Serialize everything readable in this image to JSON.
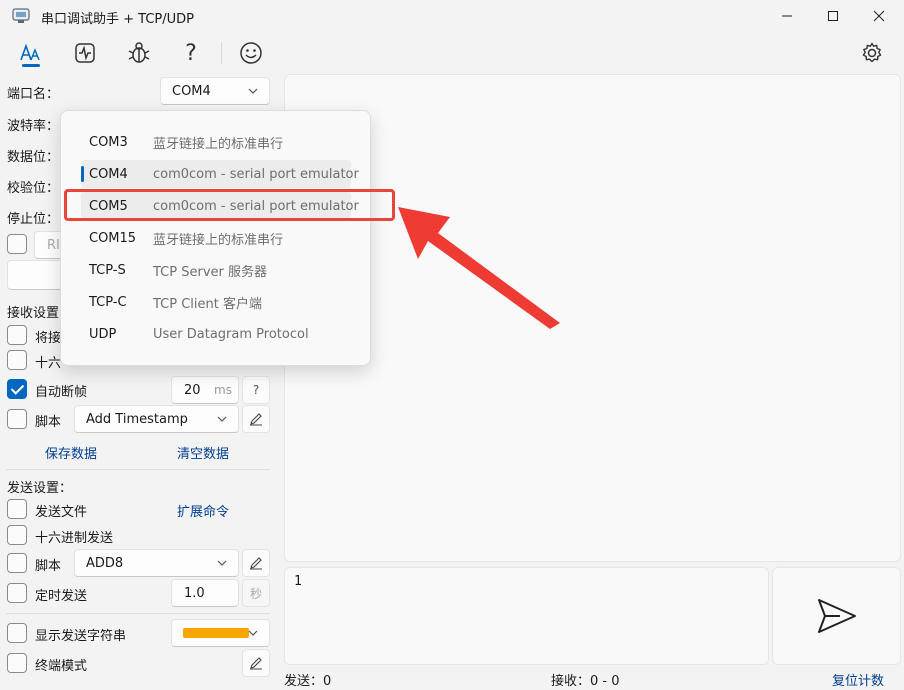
{
  "window": {
    "title": "串口调试助手 + TCP/UDP"
  },
  "toolbar": {
    "icons": [
      "font-style-icon",
      "waveform-icon",
      "bug-icon",
      "help-icon",
      "smiley-icon"
    ],
    "settings_icon": "gear-icon"
  },
  "serial": {
    "port_label": "端口名：",
    "port_value": "COM4",
    "baud_label": "波特率：",
    "databits_label": "数据位：",
    "parity_label": "校验位：",
    "stopbits_label": "停止位：",
    "partial_button": "RI"
  },
  "receive": {
    "section_label": "接收设置：",
    "save_to_file_partial": "将接",
    "hex_display_partial": "十六",
    "auto_frame_label": "自动断帧",
    "auto_frame_value": "20",
    "auto_frame_unit": "ms",
    "auto_frame_help": "?",
    "script_label": "脚本",
    "script_value": "Add Timestamp",
    "save_data": "保存数据",
    "clear_data": "清空数据"
  },
  "send": {
    "section_label": "发送设置：",
    "send_file_label": "发送文件",
    "ext_command": "扩展命令",
    "hex_send_label": "十六进制发送",
    "script_label": "脚本",
    "script_value": "ADD8",
    "timed_send_label": "定时发送",
    "timed_send_value": "1.0",
    "timed_send_unit": "秒",
    "show_send_string_label": "显示发送字符串",
    "send_color": "#f7a800",
    "terminal_mode_label": "终端模式",
    "input_text": "1"
  },
  "status": {
    "send_count": "发送：0",
    "recv_count": "接收：0 - 0",
    "reset_count": "复位计数"
  },
  "port_dropdown": {
    "items": [
      {
        "name": "COM3",
        "desc": "蓝牙链接上的标准串行"
      },
      {
        "name": "COM4",
        "desc": "com0com - serial port emulator"
      },
      {
        "name": "COM5",
        "desc": "com0com - serial port emulator"
      },
      {
        "name": "COM15",
        "desc": "蓝牙链接上的标准串行"
      },
      {
        "name": "TCP-S",
        "desc": "TCP Server 服务器"
      },
      {
        "name": "TCP-C",
        "desc": "TCP Client 客户端"
      },
      {
        "name": "UDP",
        "desc": "User Datagram Protocol"
      }
    ],
    "selected": "COM4",
    "highlighted": "COM5"
  },
  "colors": {
    "accent": "#0067c0",
    "link": "#003e92",
    "annotation": "#e8453c"
  }
}
